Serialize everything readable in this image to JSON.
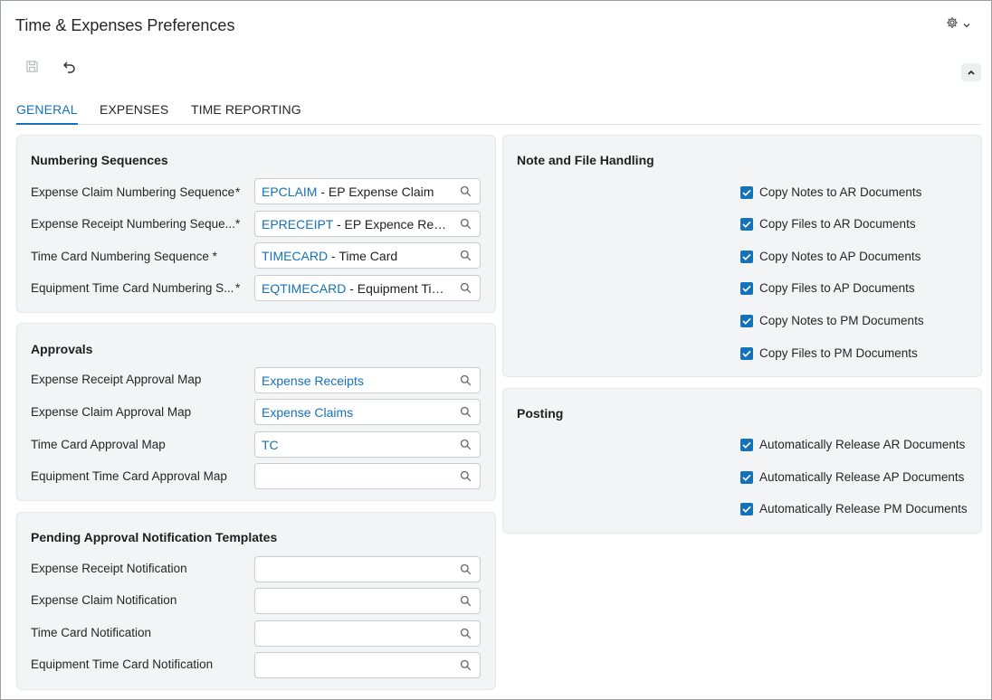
{
  "header": {
    "title": "Time & Expenses Preferences"
  },
  "tabs": [
    {
      "label": "GENERAL",
      "active": true
    },
    {
      "label": "EXPENSES",
      "active": false
    },
    {
      "label": "TIME REPORTING",
      "active": false
    }
  ],
  "numbering": {
    "title": "Numbering Sequences",
    "rows": [
      {
        "label": "Expense Claim Numbering Sequence",
        "required": "*",
        "code": "EPCLAIM",
        "desc": " - EP Expense Claim"
      },
      {
        "label": "Expense Receipt Numbering Seque...",
        "required": "*",
        "code": "EPRECEIPT",
        "desc": " - EP Expence Receipt"
      },
      {
        "label": "Time Card Numbering Sequence *",
        "required": "",
        "code": "TIMECARD",
        "desc": " - Time Card"
      },
      {
        "label": "Equipment Time Card Numbering S...",
        "required": "*",
        "code": "EQTIMECARD",
        "desc": " - Equipment Time ..."
      }
    ]
  },
  "approvals": {
    "title": "Approvals",
    "rows": [
      {
        "label": "Expense Receipt Approval Map",
        "value": "Expense Receipts"
      },
      {
        "label": "Expense Claim Approval Map",
        "value": "Expense Claims"
      },
      {
        "label": "Time Card Approval Map",
        "value": "TC"
      },
      {
        "label": "Equipment Time Card Approval Map",
        "value": ""
      }
    ]
  },
  "notifications": {
    "title": "Pending Approval Notification Templates",
    "rows": [
      {
        "label": "Expense Receipt Notification",
        "value": ""
      },
      {
        "label": "Expense Claim Notification",
        "value": ""
      },
      {
        "label": "Time Card Notification",
        "value": ""
      },
      {
        "label": "Equipment Time Card Notification",
        "value": ""
      }
    ]
  },
  "note_file": {
    "title": "Note and File Handling",
    "items": [
      {
        "label": "Copy Notes to AR Documents",
        "checked": true
      },
      {
        "label": "Copy Files to AR Documents",
        "checked": true
      },
      {
        "label": "Copy Notes to AP Documents",
        "checked": true
      },
      {
        "label": "Copy Files to AP Documents",
        "checked": true
      },
      {
        "label": "Copy Notes to PM Documents",
        "checked": true
      },
      {
        "label": "Copy Files to PM Documents",
        "checked": true
      }
    ]
  },
  "posting": {
    "title": "Posting",
    "items": [
      {
        "label": "Automatically Release AR Documents",
        "checked": true
      },
      {
        "label": "Automatically Release AP Documents",
        "checked": true
      },
      {
        "label": "Automatically Release PM Documents",
        "checked": true
      }
    ]
  },
  "icons": {
    "gear": "gear-icon",
    "dropdown": "chevron-down-icon",
    "save": "save-icon",
    "undo": "undo-icon",
    "collapse": "chevron-up-icon",
    "search": "search-icon",
    "check": "checkmark-icon"
  },
  "colors": {
    "accent": "#1572b8",
    "panel": "#f3f4f6"
  }
}
